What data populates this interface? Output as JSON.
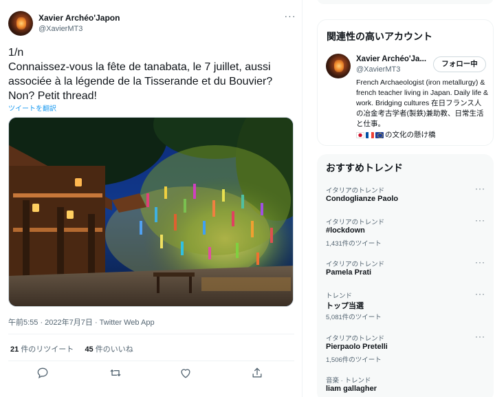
{
  "tweet": {
    "author_name": "Xavier Archéo'Japon",
    "author_handle": "@XavierMT3",
    "more_label": "···",
    "text": "1/n\nConnaissez-vous la fête de tanabata, le 7 juillet, aussi associée à la légende de la Tisserande et du Bouvier? Non? Petit thread!",
    "translate_label": "ツイートを翻訳",
    "timestamp": "午前5:55 · 2022年7月7日 · Twitter Web App",
    "retweet_count": "21",
    "retweet_label": "件のリツイート",
    "like_count": "45",
    "like_label": "件のいいね"
  },
  "sidebar": {
    "related": {
      "title": "関連性の高いアカウント",
      "name": "Xavier Archéo'Ja...",
      "handle": "@XavierMT3",
      "follow_label": "フォロー中",
      "bio": "French Archaeologist (iron metallurgy) & french teacher living in Japan. Daily life & work. Bridging cultures 在日フランス人の冶金考古学者(製鉄)兼助教、日常生活と仕事。",
      "bio_suffix": "の文化の懸け橋"
    },
    "trends": {
      "title": "おすすめトレンド",
      "items": [
        {
          "meta": "イタリアのトレンド",
          "name": "Condoglianze Paolo",
          "count": ""
        },
        {
          "meta": "イタリアのトレンド",
          "name": "#lockdown",
          "count": "1,431件のツイート"
        },
        {
          "meta": "イタリアのトレンド",
          "name": "Pamela Prati",
          "count": ""
        },
        {
          "meta": "トレンド",
          "name": "トップ当選",
          "count": "5,081件のツイート"
        },
        {
          "meta": "イタリアのトレンド",
          "name": "Pierpaolo Pretelli",
          "count": "1,506件のツイート"
        },
        {
          "meta": "音楽 · トレンド",
          "name": "liam gallagher",
          "count": ""
        }
      ],
      "more_label": "···"
    }
  },
  "icons": {
    "reply": "reply-icon",
    "retweet": "retweet-icon",
    "like": "heart-icon",
    "share": "share-icon"
  },
  "colors": {
    "link": "#1d9bf0",
    "secondary_text": "#536471"
  }
}
